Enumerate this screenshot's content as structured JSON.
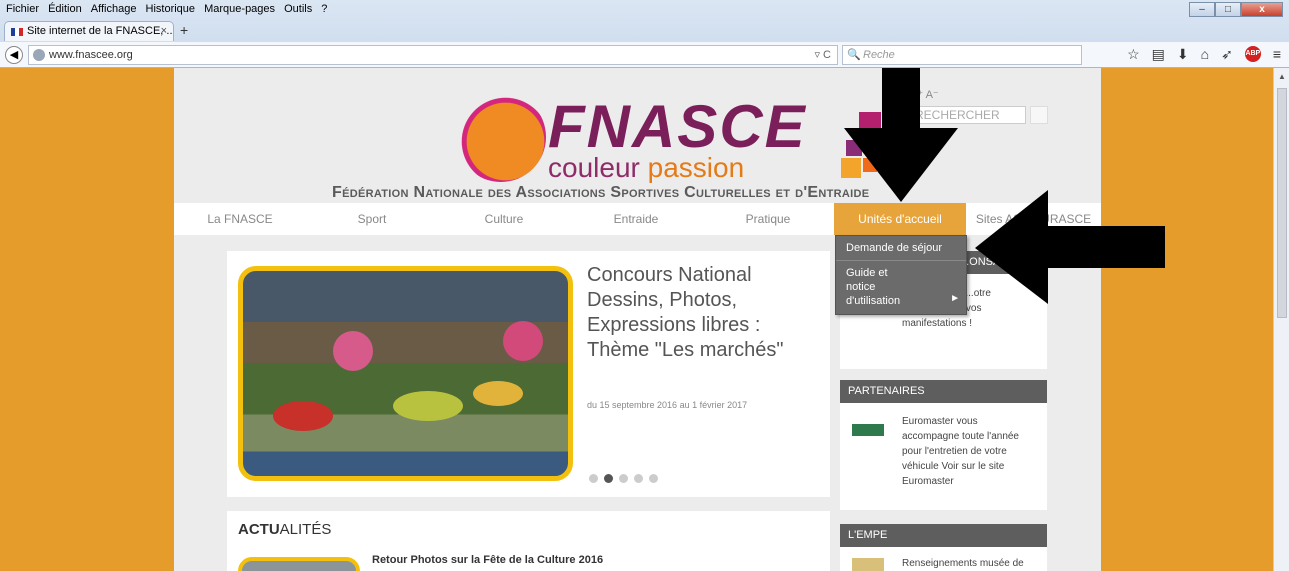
{
  "menubar": [
    "Fichier",
    "Édition",
    "Affichage",
    "Historique",
    "Marque-pages",
    "Outils",
    "?"
  ],
  "window_controls": {
    "minimize": "–",
    "maximize": "□",
    "close": "x"
  },
  "tab": {
    "title": "Site internet de la FNASCE, ...",
    "close": "×",
    "new_tab": "+"
  },
  "address_bar": {
    "url": "www.fnascee.org",
    "reload": "▿ C",
    "search_placeholder": "Reche"
  },
  "toolbar_icons": [
    "star-icon",
    "bookmarks-icon",
    "download-icon",
    "home-icon",
    "send-icon",
    "adblock-icon",
    "menu-icon"
  ],
  "site": {
    "logo": {
      "name": "FNASCE",
      "tagline_1": "couleur",
      "tagline_2": "passion"
    },
    "federation": "Fédération Nationale des Associations Sportives Culturelles et d'Entraide",
    "font_size_controls": "A⁺ A⁻",
    "search_placeholder": "RECHERCHER",
    "menu": [
      "La FNASCE",
      "Sport",
      "Culture",
      "Entraide",
      "Pratique",
      "Unités d'accueil",
      "Sites ASCE/URASCE"
    ],
    "dropdown": {
      "item1": "Demande de séjour",
      "item2": "Guide et notice d'utilisation",
      "submenu_arrow": "►"
    },
    "slide": {
      "title": "Concours National Dessins, Photos, Expressions libres : Thème \"Les marchés\"",
      "date": "du 15 septembre 2016 au 1 février 2017",
      "dots_count": 5,
      "active_dot": 2
    },
    "news": {
      "heading_bold": "ACTU",
      "heading_rest": "ALITÉS",
      "item_title": "Retour Photos sur la Fête de la Culture 2016"
    },
    "sponsors_box": {
      "title": "...ONSA",
      "text": "...eloppement ...otre association et vos manifestations !"
    },
    "partners_box": {
      "title": "PARTENAIRES",
      "text": "Euromaster vous accompagne toute l'année pour l'entretien de votre véhicule Voir sur le site Euromaster"
    },
    "empe_box": {
      "title": "L'EMPE",
      "text": "Renseignements musée de"
    }
  },
  "colors": {
    "site_bg": "#e69c2b",
    "menu_active": "#e6a43a",
    "box_header": "#5e5e5e",
    "brand_purple": "#7a1f5a",
    "brand_orange": "#f08a22"
  }
}
